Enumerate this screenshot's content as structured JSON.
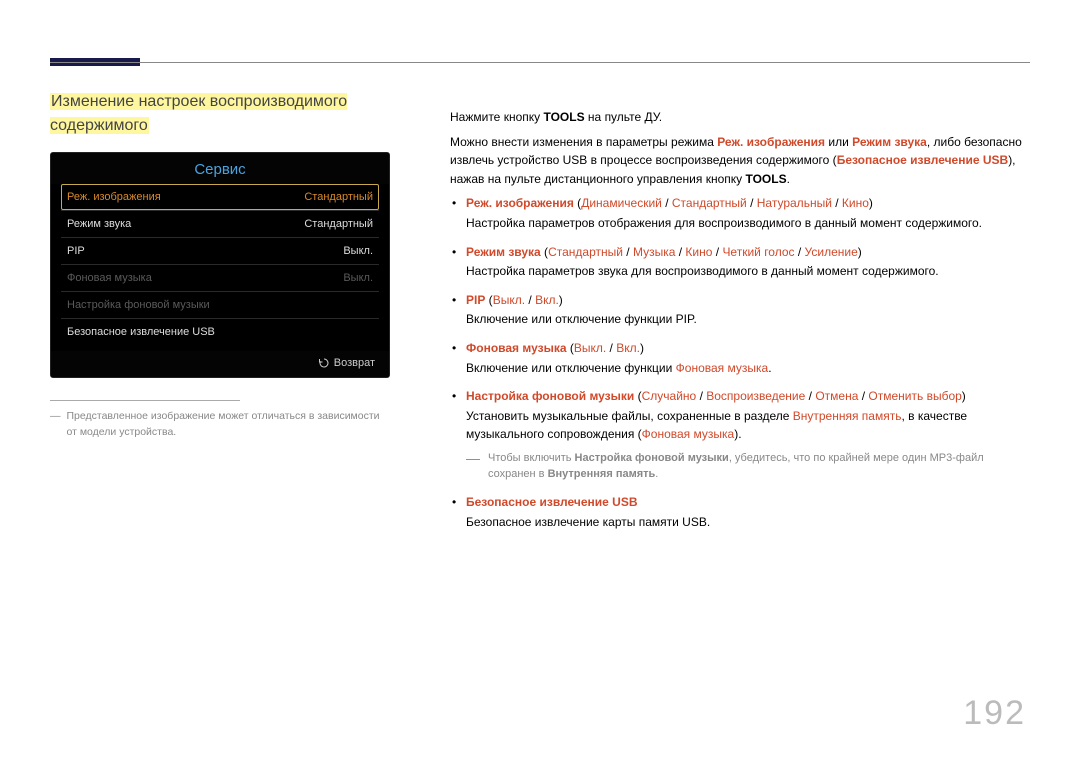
{
  "page_number": "192",
  "section_title": "Изменение настроек воспроизводимого содержимого",
  "tv_menu": {
    "header": "Сервис",
    "rows": [
      {
        "label": "Реж. изображения",
        "value": "Стандартный",
        "state": "selected"
      },
      {
        "label": "Режим звука",
        "value": "Стандартный",
        "state": ""
      },
      {
        "label": "PIP",
        "value": "Выкл.",
        "state": ""
      },
      {
        "label": "Фоновая музыка",
        "value": "Выкл.",
        "state": "dim"
      },
      {
        "label": "Настройка фоновой музыки",
        "value": "",
        "state": "dim"
      },
      {
        "label": "Безопасное извлечение USB",
        "value": "",
        "state": ""
      }
    ],
    "footer": "Возврат"
  },
  "left_footnote": "Представленное изображение может отличаться в зависимости от модели устройства.",
  "intro": {
    "line1_pre": "Нажмите кнопку ",
    "line1_bold": "TOOLS",
    "line1_post": " на пульте ДУ.",
    "p2_a": "Можно внести изменения в параметры режима ",
    "p2_r1": "Реж. изображения",
    "p2_b": " или ",
    "p2_r2": "Режим звука",
    "p2_c": ", либо безопасно извлечь устройство USB в процессе воспроизведения содержимого (",
    "p2_r3": "Безопасное извлечение USB",
    "p2_d": "), нажав на пульте дистанционного управления кнопку ",
    "p2_bold": "TOOLS",
    "p2_e": "."
  },
  "options": [
    {
      "head_parts": [
        {
          "t": "Реж. изображения",
          "c": "redbold"
        },
        {
          "t": " (",
          "c": ""
        },
        {
          "t": "Динамический",
          "c": "red"
        },
        {
          "t": " / ",
          "c": ""
        },
        {
          "t": "Стандартный",
          "c": "red"
        },
        {
          "t": " / ",
          "c": ""
        },
        {
          "t": "Натуральный",
          "c": "red"
        },
        {
          "t": " / ",
          "c": ""
        },
        {
          "t": "Кино",
          "c": "red"
        },
        {
          "t": ")",
          "c": ""
        }
      ],
      "desc": "Настройка параметров отображения для воспроизводимого в данный момент содержимого."
    },
    {
      "head_parts": [
        {
          "t": "Режим звука",
          "c": "redbold"
        },
        {
          "t": " (",
          "c": ""
        },
        {
          "t": "Стандартный",
          "c": "red"
        },
        {
          "t": " / ",
          "c": ""
        },
        {
          "t": "Музыка",
          "c": "red"
        },
        {
          "t": "  / ",
          "c": ""
        },
        {
          "t": "Кино",
          "c": "red"
        },
        {
          "t": " / ",
          "c": ""
        },
        {
          "t": "Четкий голос",
          "c": "red"
        },
        {
          "t": " / ",
          "c": ""
        },
        {
          "t": "Усиление",
          "c": "red"
        },
        {
          "t": ")",
          "c": ""
        }
      ],
      "desc": "Настройка параметров звука для воспроизводимого в данный момент содержимого."
    },
    {
      "head_parts": [
        {
          "t": "PIP",
          "c": "redbold"
        },
        {
          "t": " (",
          "c": ""
        },
        {
          "t": "Выкл.",
          "c": "red"
        },
        {
          "t": " / ",
          "c": ""
        },
        {
          "t": "Вкл.",
          "c": "red"
        },
        {
          "t": ")",
          "c": ""
        }
      ],
      "desc": "Включение или отключение функции PIP."
    },
    {
      "head_parts": [
        {
          "t": "Фоновая музыка",
          "c": "redbold"
        },
        {
          "t": " (",
          "c": ""
        },
        {
          "t": "Выкл.",
          "c": "red"
        },
        {
          "t": " / ",
          "c": ""
        },
        {
          "t": "Вкл.",
          "c": "red"
        },
        {
          "t": ")",
          "c": ""
        }
      ],
      "desc_parts": [
        {
          "t": "Включение или отключение функции ",
          "c": ""
        },
        {
          "t": "Фоновая музыка",
          "c": "red"
        },
        {
          "t": ".",
          "c": ""
        }
      ]
    },
    {
      "head_parts": [
        {
          "t": "Настройка фоновой музыки",
          "c": "redbold"
        },
        {
          "t": " (",
          "c": ""
        },
        {
          "t": "Случайно",
          "c": "red"
        },
        {
          "t": " / ",
          "c": ""
        },
        {
          "t": "Воспроизведение",
          "c": "red"
        },
        {
          "t": " / ",
          "c": ""
        },
        {
          "t": "Отмена",
          "c": "red"
        },
        {
          "t": " / ",
          "c": ""
        },
        {
          "t": "Отменить выбор",
          "c": "red"
        },
        {
          "t": ")",
          "c": ""
        }
      ],
      "desc_parts": [
        {
          "t": "Установить музыкальные файлы, сохраненные в разделе ",
          "c": ""
        },
        {
          "t": "Внутренняя память",
          "c": "red"
        },
        {
          "t": ", в качестве музыкального сопровождения (",
          "c": ""
        },
        {
          "t": "Фоновая музыка",
          "c": "red"
        },
        {
          "t": ").",
          "c": ""
        }
      ],
      "subnote_parts": [
        {
          "t": "Чтобы включить ",
          "c": "grey"
        },
        {
          "t": "Настройка фоновой музыки",
          "c": "bold"
        },
        {
          "t": ", убедитесь, что по крайней мере один MP3-файл сохранен в ",
          "c": "grey"
        },
        {
          "t": "Внутренняя память",
          "c": "bold"
        },
        {
          "t": ".",
          "c": "grey"
        }
      ]
    },
    {
      "head_parts": [
        {
          "t": "Безопасное извлечение USB",
          "c": "redbold"
        }
      ],
      "desc": "Безопасное извлечение карты памяти USB."
    }
  ]
}
